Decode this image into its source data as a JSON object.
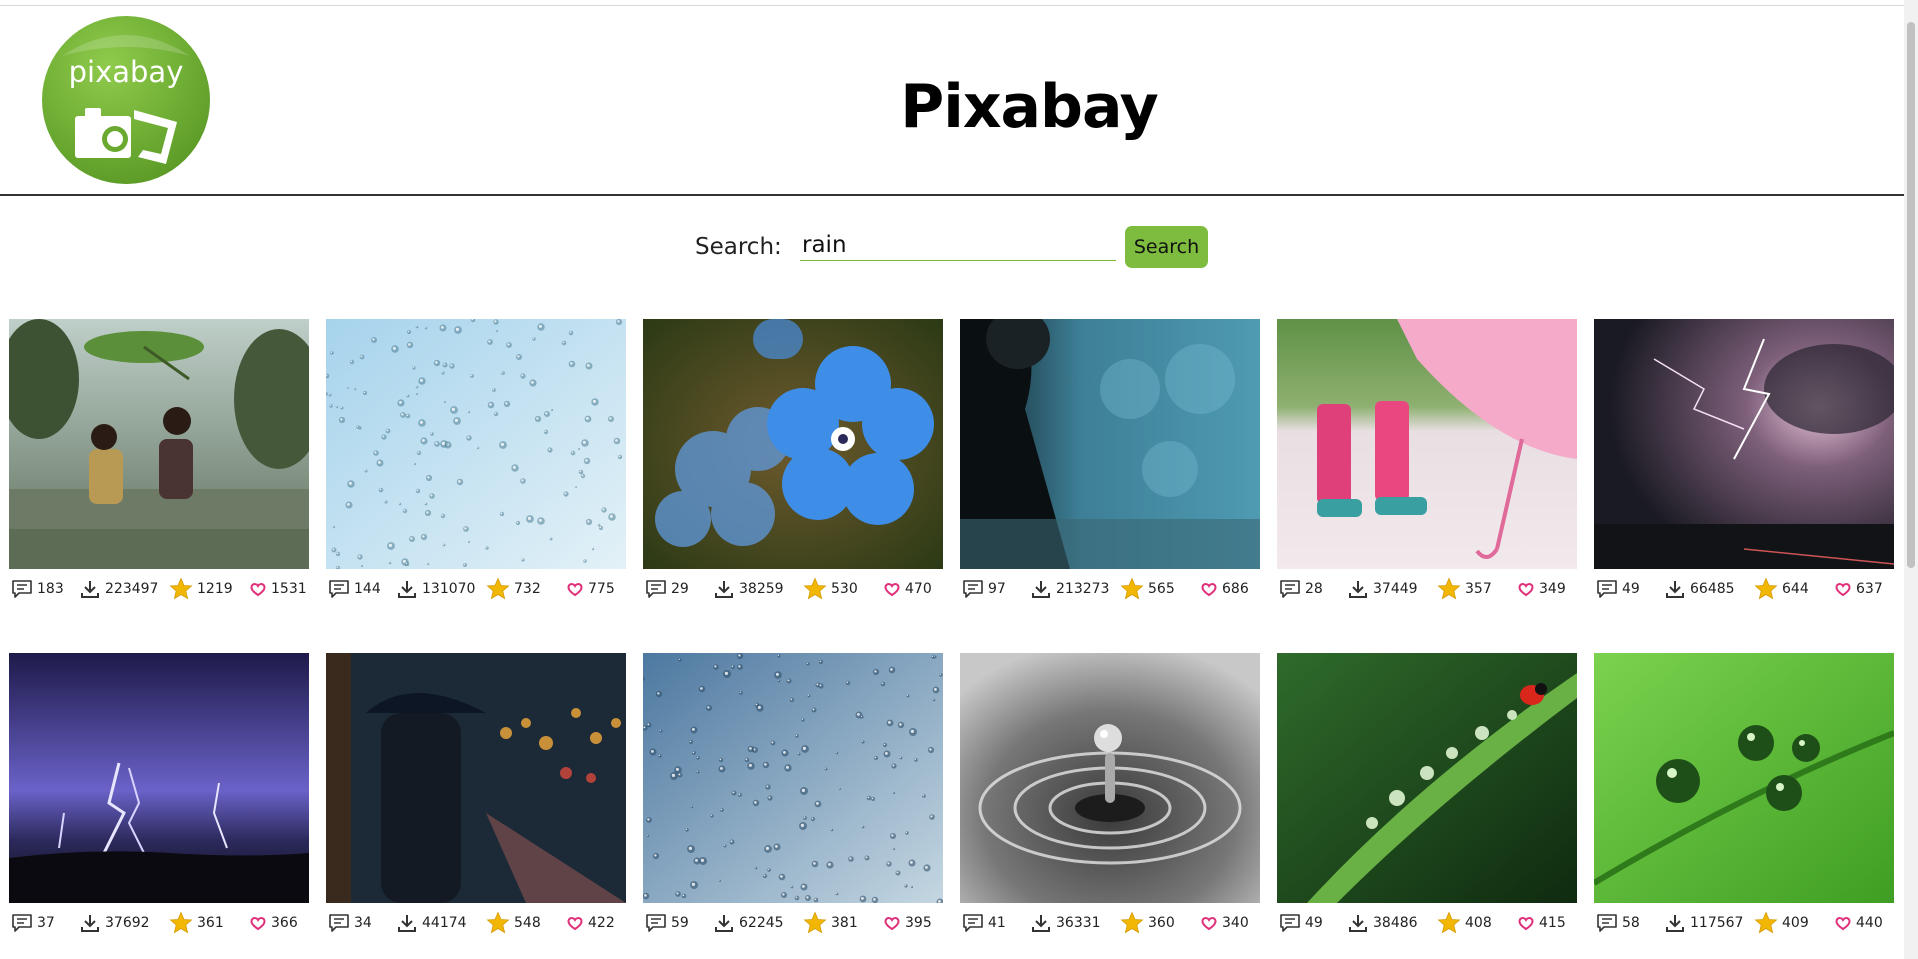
{
  "header": {
    "logo_text": "pixabay",
    "title": "Pixabay"
  },
  "search": {
    "label": "Search:",
    "value": "rain",
    "button_label": "Search"
  },
  "colors": {
    "brand_green": "#7dbc3e",
    "heart_pink": "#e0307a",
    "star_yellow": "#f2b705"
  },
  "icons": {
    "comments": "comment-icon",
    "downloads": "download-icon",
    "favorites": "star-icon",
    "likes": "heart-icon"
  },
  "images": [
    {
      "scene": "children-under-leaf",
      "comments": "183",
      "downloads": "223497",
      "favorites": "1219",
      "likes": "1531"
    },
    {
      "scene": "raindrops-glass-light",
      "comments": "144",
      "downloads": "131070",
      "favorites": "732",
      "likes": "775"
    },
    {
      "scene": "blue-flower-drops",
      "comments": "29",
      "downloads": "38259",
      "favorites": "530",
      "likes": "470"
    },
    {
      "scene": "man-in-rain",
      "comments": "97",
      "downloads": "213273",
      "favorites": "565",
      "likes": "686"
    },
    {
      "scene": "pink-boots-umbrella",
      "comments": "28",
      "downloads": "37449",
      "favorites": "357",
      "likes": "349"
    },
    {
      "scene": "lightning-dark-clouds",
      "comments": "49",
      "downloads": "66485",
      "favorites": "644",
      "likes": "637"
    },
    {
      "scene": "purple-lightning",
      "comments": "37",
      "downloads": "37692",
      "favorites": "361",
      "likes": "366"
    },
    {
      "scene": "umbrella-city-night",
      "comments": "34",
      "downloads": "44174",
      "favorites": "548",
      "likes": "422"
    },
    {
      "scene": "raindrops-glass-blue",
      "comments": "59",
      "downloads": "62245",
      "favorites": "381",
      "likes": "395"
    },
    {
      "scene": "water-drop-ripple",
      "comments": "41",
      "downloads": "36331",
      "favorites": "360",
      "likes": "340"
    },
    {
      "scene": "ladybug-grass-blade",
      "comments": "49",
      "downloads": "38486",
      "favorites": "408",
      "likes": "415"
    },
    {
      "scene": "drops-on-stem",
      "comments": "58",
      "downloads": "117567",
      "favorites": "409",
      "likes": "440"
    }
  ]
}
